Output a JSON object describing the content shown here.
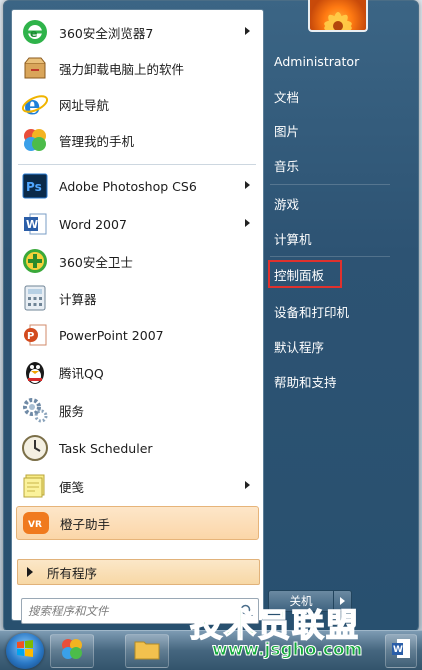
{
  "programs": [
    {
      "label": "360安全浏览器7",
      "icon": "360-browser-icon",
      "arrow": true
    },
    {
      "label": "强力卸载电脑上的软件",
      "icon": "uninstall-box-icon",
      "arrow": false
    },
    {
      "label": "网址导航",
      "icon": "ie-icon",
      "arrow": false
    },
    {
      "label": "管理我的手机",
      "icon": "phone-manager-icon",
      "arrow": false
    },
    {
      "label": "Adobe Photoshop CS6",
      "icon": "photoshop-icon",
      "arrow": true
    },
    {
      "label": "Word 2007",
      "icon": "word-icon",
      "arrow": true
    },
    {
      "label": "360安全卫士",
      "icon": "360-safe-icon",
      "arrow": false
    },
    {
      "label": "计算器",
      "icon": "calculator-icon",
      "arrow": false
    },
    {
      "label": "PowerPoint 2007",
      "icon": "powerpoint-icon",
      "arrow": false
    },
    {
      "label": "腾讯QQ",
      "icon": "qq-penguin-icon",
      "arrow": false
    },
    {
      "label": "服务",
      "icon": "services-gear-icon",
      "arrow": false
    },
    {
      "label": "Task Scheduler",
      "icon": "clock-icon",
      "arrow": false
    },
    {
      "label": "便笺",
      "icon": "sticky-notes-icon",
      "arrow": true
    },
    {
      "label": "橙子助手",
      "icon": "orange-assistant-icon",
      "arrow": false,
      "highlighted": true
    }
  ],
  "all_programs_label": "所有程序",
  "search": {
    "placeholder": "搜索程序和文件"
  },
  "right_items": [
    {
      "label": "Administrator"
    },
    {
      "label": "文档"
    },
    {
      "label": "图片"
    },
    {
      "label": "音乐"
    },
    {
      "label": "游戏"
    },
    {
      "label": "计算机"
    },
    {
      "label": "控制面板",
      "boxed": true
    },
    {
      "label": "设备和打印机"
    },
    {
      "label": "默认程序"
    },
    {
      "label": "帮助和支持"
    }
  ],
  "shutdown_label": "关机",
  "watermark": {
    "cn": "技术员联盟",
    "url": "www.jsgho.com"
  },
  "colors": {
    "highlight_box": "#e0312d",
    "menu_blue": "#2d5373"
  }
}
